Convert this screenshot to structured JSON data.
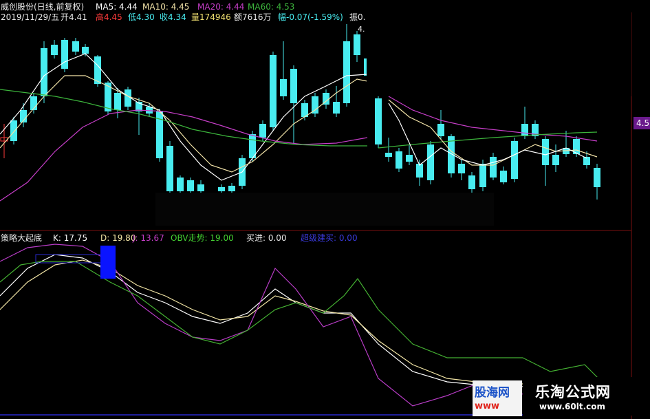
{
  "header": {
    "stock_name": "威创股份(日线,前复权)",
    "ma5": "MA5: 4.44",
    "ma10": "MA10: 4.45",
    "ma20": "MA20: 4.44",
    "ma60": "MA60: 4.53",
    "date": "2019/11/29/五",
    "open": "开4.41",
    "high": "高4.45",
    "low": "低4.30",
    "close": "收4.34",
    "volume": "量174946",
    "amount": "额7616万",
    "change": "幅-0.07(-1.59%)",
    "amplitude": "振0.",
    "peak_price": "4."
  },
  "price_badge": "4.5",
  "indicator": {
    "name": "策略大起底",
    "k": "K: 17.75",
    "d": "D: 19.80",
    "j": "J: 13.67",
    "obv": "OBV走势: 19.00",
    "buy": "买进: 0.00",
    "extra": "超级建买: 0.00"
  },
  "colors": {
    "up": "#ff3b3b",
    "down": "#48ecf0",
    "ma5": "#ffffff",
    "ma10": "#f2e3a8",
    "ma20": "#c63ec8",
    "ma60": "#3cb43c",
    "kdj_k": "#ffffff",
    "kdj_d": "#f3e6a6",
    "kdj_j": "#b83cc6",
    "obv": "#44b032",
    "axis": "#7a1010"
  },
  "watermarks": {
    "left_top": "股海网",
    "left_bottom": "www",
    "right_top": "乐淘公式网",
    "right_bottom": "www.60lt.com"
  }
}
